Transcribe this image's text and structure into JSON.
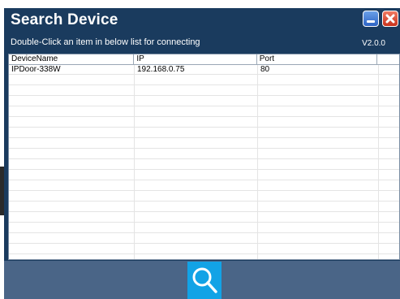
{
  "window": {
    "title": "Search Device",
    "subtitle": "Double-Click an item in below list for connecting",
    "version": "V2.0.0",
    "minimize_icon": "minimize-icon",
    "close_icon": "close-icon"
  },
  "table": {
    "columns": [
      "DeviceName",
      "IP",
      "Port",
      ""
    ],
    "rows": [
      {
        "name": "IPDoor-338W",
        "ip": "192.168.0.75",
        "port": "80"
      }
    ]
  },
  "toolbar": {
    "search_icon": "search-icon"
  },
  "colors": {
    "window_bg": "#1a3b5e",
    "bottom_bar": "#4a6587",
    "search_button": "#12a3e6",
    "minimize_button": "#2d63c4",
    "close_button": "#c8321c"
  }
}
